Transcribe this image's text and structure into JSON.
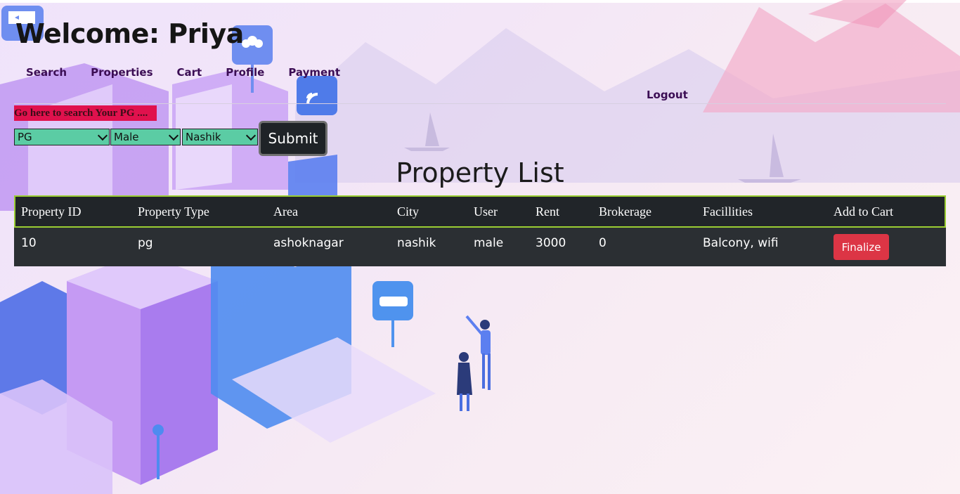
{
  "header": {
    "welcome": "Welcome: Priya"
  },
  "nav": {
    "items": [
      "Search",
      "Properties",
      "Cart",
      "Profile",
      "Payment"
    ],
    "logout": "Logout"
  },
  "search": {
    "link_text": "Go here to search Your PG ....",
    "type_value": "PG",
    "gender_value": "Male",
    "city_value": "Nashik",
    "submit_label": "Submit"
  },
  "list": {
    "title": "Property List",
    "columns": [
      "Property ID",
      "Property Type",
      "Area",
      "City",
      "User",
      "Rent",
      "Brokerage",
      "Facillities",
      "Add to Cart"
    ],
    "rows": [
      {
        "id": "10",
        "type": "pg",
        "area": "ashoknagar",
        "city": "nashik",
        "user": "male",
        "rent": "3000",
        "brokerage": "0",
        "facilities": "Balcony, wifi",
        "action": "Finalize"
      }
    ]
  },
  "colors": {
    "accent_red": "#dc3545",
    "select_green": "#5bcca4",
    "table_dark": "#212529",
    "header_border": "#9acd32"
  }
}
